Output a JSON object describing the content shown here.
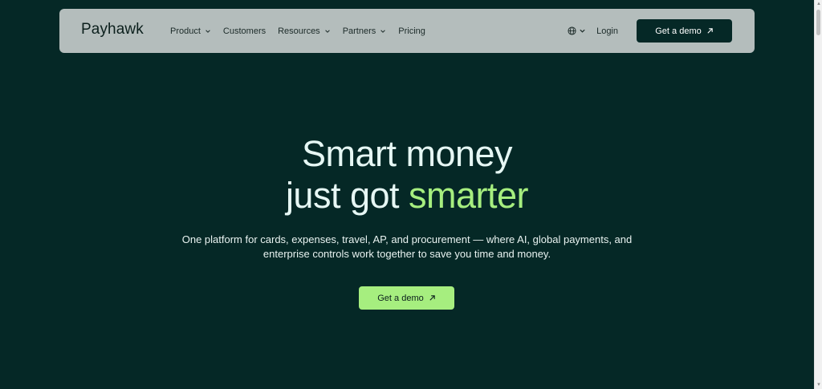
{
  "nav": {
    "logo": "Payhawk",
    "items": [
      {
        "label": "Product",
        "has_dropdown": true
      },
      {
        "label": "Customers",
        "has_dropdown": false
      },
      {
        "label": "Resources",
        "has_dropdown": true
      },
      {
        "label": "Partners",
        "has_dropdown": true
      },
      {
        "label": "Pricing",
        "has_dropdown": false
      }
    ],
    "language_icon": "globe-icon",
    "login_label": "Login",
    "demo_label": "Get a demo"
  },
  "hero": {
    "title_line1": "Smart money",
    "title_line2_prefix": "just got ",
    "title_line2_accent": "smarter",
    "subtitle_line1": "One platform for cards, expenses, travel, AP, and procurement — where AI, global payments, and",
    "subtitle_line2": "enterprise controls work together to save you time and money.",
    "cta_label": "Get a demo"
  },
  "colors": {
    "background": "#052826",
    "nav_background": "#b4bdbc",
    "accent": "#a6ee7f",
    "text_light": "#e6f7f4"
  }
}
